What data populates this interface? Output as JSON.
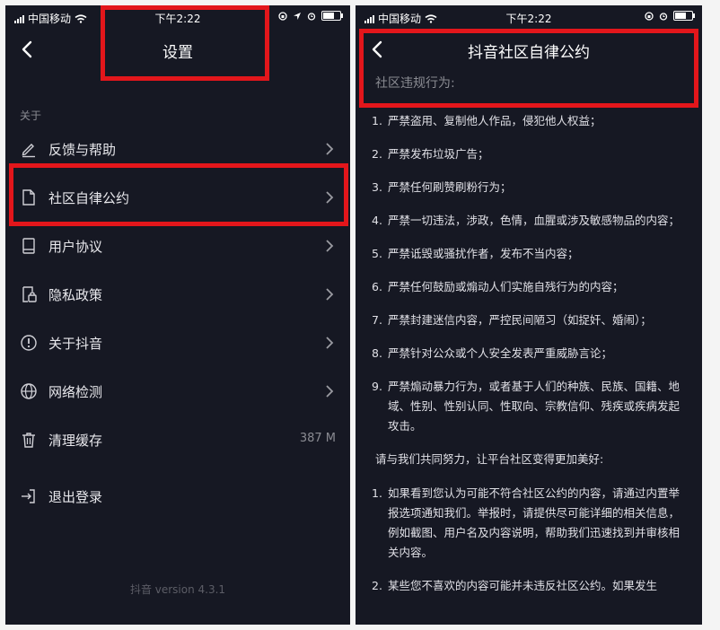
{
  "status_bar": {
    "carrier": "中国移动",
    "time": "下午2:22"
  },
  "left_screen": {
    "title": "设置",
    "section_label": "关于",
    "menu": [
      {
        "label": "反馈与帮助",
        "icon": "edit-icon"
      },
      {
        "label": "社区自律公约",
        "icon": "document-icon"
      },
      {
        "label": "用户协议",
        "icon": "book-icon"
      },
      {
        "label": "隐私政策",
        "icon": "privacy-lock-icon"
      },
      {
        "label": "关于抖音",
        "icon": "info-icon"
      },
      {
        "label": "网络检测",
        "icon": "globe-icon"
      },
      {
        "label": "清理缓存",
        "icon": "trash-icon",
        "value": "387 M"
      }
    ],
    "logout_label": "退出登录",
    "version": "抖音 version 4.3.1"
  },
  "right_screen": {
    "title": "抖音社区自律公约",
    "section_heading": "社区违规行为:",
    "rules": [
      {
        "num": "1.",
        "text": "严禁盗用、复制他人作品，侵犯他人权益；"
      },
      {
        "num": "2.",
        "text": "严禁发布垃圾广告；"
      },
      {
        "num": "3.",
        "text": "严禁任何刷赞刷粉行为；"
      },
      {
        "num": "4.",
        "text": "严禁一切违法，涉政，色情，血腥或涉及敏感物品的内容；"
      },
      {
        "num": "5.",
        "text": "严禁诋毁或骚扰作者，发布不当内容；"
      },
      {
        "num": "6.",
        "text": "严禁任何鼓励或煽动人们实施自残行为的内容；"
      },
      {
        "num": "7.",
        "text": "严禁封建迷信内容，严控民间陋习（如捉奸、婚闹）；"
      },
      {
        "num": "8.",
        "text": "严禁针对公众或个人安全发表严重威胁言论；"
      },
      {
        "num": "9.",
        "text": "严禁煽动暴力行为，或者基于人们的种族、民族、国籍、地域、性别、性别认同、性取向、宗教信仰、残疾或疾病发起攻击。"
      }
    ],
    "intro": "请与我们共同努力，让平台社区变得更加美好:",
    "tips": [
      {
        "num": "1.",
        "text": "如果看到您认为可能不符合社区公约的内容，请通过内置举报选项通知我们。举报时，请提供尽可能详细的相关信息，例如截图、用户名及内容说明，帮助我们迅速找到并审核相关内容。"
      },
      {
        "num": "2.",
        "text": "某些您不喜欢的内容可能并未违反社区公约。如果发生"
      }
    ]
  },
  "colors": {
    "background": "#161823",
    "highlight": "#e3161b",
    "muted_text": "#8a8b92"
  }
}
